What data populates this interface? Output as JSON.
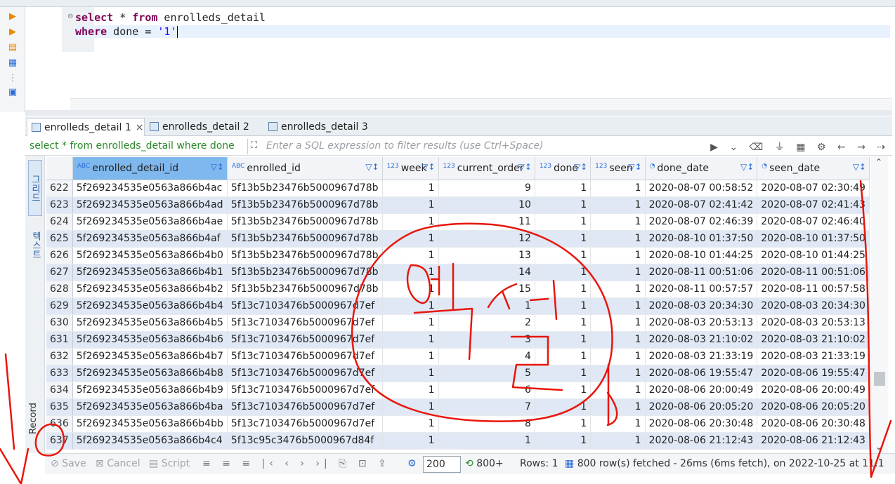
{
  "editor": {
    "lines": [
      {
        "kw": "select",
        "rest": " * ",
        "kw2": "from",
        "rest2": " enrolleds_detail"
      },
      {
        "kw": "where",
        "rest": " done = ",
        "str": "'1'"
      }
    ]
  },
  "result_tabs": [
    {
      "label": "enrolleds_detail 1"
    },
    {
      "label": "enrolleds_detail 2"
    },
    {
      "label": "enrolleds_detail 3"
    }
  ],
  "filter": {
    "label": "select * from enrolleds_detail where done",
    "placeholder": "Enter a SQL expression to filter results (use Ctrl+Space)"
  },
  "side_tabs": {
    "grid": "그리드",
    "text": "텍스트",
    "record": "Record"
  },
  "columns": [
    {
      "type": "ABC",
      "name": "enrolled_detail_id"
    },
    {
      "type": "ABC",
      "name": "enrolled_id"
    },
    {
      "type": "123",
      "name": "week"
    },
    {
      "type": "123",
      "name": "current_order"
    },
    {
      "type": "123",
      "name": "done"
    },
    {
      "type": "123",
      "name": "seen"
    },
    {
      "type": "clock",
      "name": "done_date"
    },
    {
      "type": "clock",
      "name": "seen_date"
    }
  ],
  "rows": [
    [
      "622",
      "5f269234535e0563a866b4ac",
      "5f13b5b23476b5000967d78b",
      "1",
      "9",
      "1",
      "1",
      "2020-08-07 00:58:52",
      "2020-08-07 02:30:49"
    ],
    [
      "623",
      "5f269234535e0563a866b4ad",
      "5f13b5b23476b5000967d78b",
      "1",
      "10",
      "1",
      "1",
      "2020-08-07 02:41:42",
      "2020-08-07 02:41:43"
    ],
    [
      "624",
      "5f269234535e0563a866b4ae",
      "5f13b5b23476b5000967d78b",
      "1",
      "11",
      "1",
      "1",
      "2020-08-07 02:46:39",
      "2020-08-07 02:46:40"
    ],
    [
      "625",
      "5f269234535e0563a866b4af",
      "5f13b5b23476b5000967d78b",
      "1",
      "12",
      "1",
      "1",
      "2020-08-10 01:37:50",
      "2020-08-10 01:37:50"
    ],
    [
      "626",
      "5f269234535e0563a866b4b0",
      "5f13b5b23476b5000967d78b",
      "1",
      "13",
      "1",
      "1",
      "2020-08-10 01:44:25",
      "2020-08-10 01:44:25"
    ],
    [
      "627",
      "5f269234535e0563a866b4b1",
      "5f13b5b23476b5000967d78b",
      "1",
      "14",
      "1",
      "1",
      "2020-08-11 00:51:06",
      "2020-08-11 00:51:06"
    ],
    [
      "628",
      "5f269234535e0563a866b4b2",
      "5f13b5b23476b5000967d78b",
      "1",
      "15",
      "1",
      "1",
      "2020-08-11 00:57:57",
      "2020-08-11 00:57:58"
    ],
    [
      "629",
      "5f269234535e0563a866b4b4",
      "5f13c7103476b5000967d7ef",
      "1",
      "1",
      "1",
      "1",
      "2020-08-03 20:34:30",
      "2020-08-03 20:34:30"
    ],
    [
      "630",
      "5f269234535e0563a866b4b5",
      "5f13c7103476b5000967d7ef",
      "1",
      "2",
      "1",
      "1",
      "2020-08-03 20:53:13",
      "2020-08-03 20:53:13"
    ],
    [
      "631",
      "5f269234535e0563a866b4b6",
      "5f13c7103476b5000967d7ef",
      "1",
      "3",
      "1",
      "1",
      "2020-08-03 21:10:02",
      "2020-08-03 21:10:02"
    ],
    [
      "632",
      "5f269234535e0563a866b4b7",
      "5f13c7103476b5000967d7ef",
      "1",
      "4",
      "1",
      "1",
      "2020-08-03 21:33:19",
      "2020-08-03 21:33:19"
    ],
    [
      "633",
      "5f269234535e0563a866b4b8",
      "5f13c7103476b5000967d7ef",
      "1",
      "5",
      "1",
      "1",
      "2020-08-06 19:55:47",
      "2020-08-06 19:55:47"
    ],
    [
      "634",
      "5f269234535e0563a866b4b9",
      "5f13c7103476b5000967d7ef",
      "1",
      "6",
      "1",
      "1",
      "2020-08-06 20:00:49",
      "2020-08-06 20:00:49"
    ],
    [
      "635",
      "5f269234535e0563a866b4ba",
      "5f13c7103476b5000967d7ef",
      "1",
      "7",
      "1",
      "1",
      "2020-08-06 20:05:20",
      "2020-08-06 20:05:20"
    ],
    [
      "636",
      "5f269234535e0563a866b4bb",
      "5f13c7103476b5000967d7ef",
      "1",
      "8",
      "1",
      "1",
      "2020-08-06 20:30:48",
      "2020-08-06 20:30:48"
    ],
    [
      "637",
      "5f269234535e0563a866b4c4",
      "5f13c95c3476b5000967d84f",
      "1",
      "1",
      "1",
      "1",
      "2020-08-06 21:12:43",
      "2020-08-06 21:12:43"
    ]
  ],
  "status": {
    "save": "Save",
    "cancel": "Cancel",
    "script": "Script",
    "fetch_size": "200",
    "fetch_all": "800+",
    "rows_label": "Rows: 1",
    "summary": "800 row(s) fetched - 26ms (6ms fetch), on 2022-10-25 at 11:1"
  },
  "colors": {
    "selected_header": "#7fb8ee",
    "alt_row": "#dfe8f4",
    "annotation": "#e8160c"
  }
}
